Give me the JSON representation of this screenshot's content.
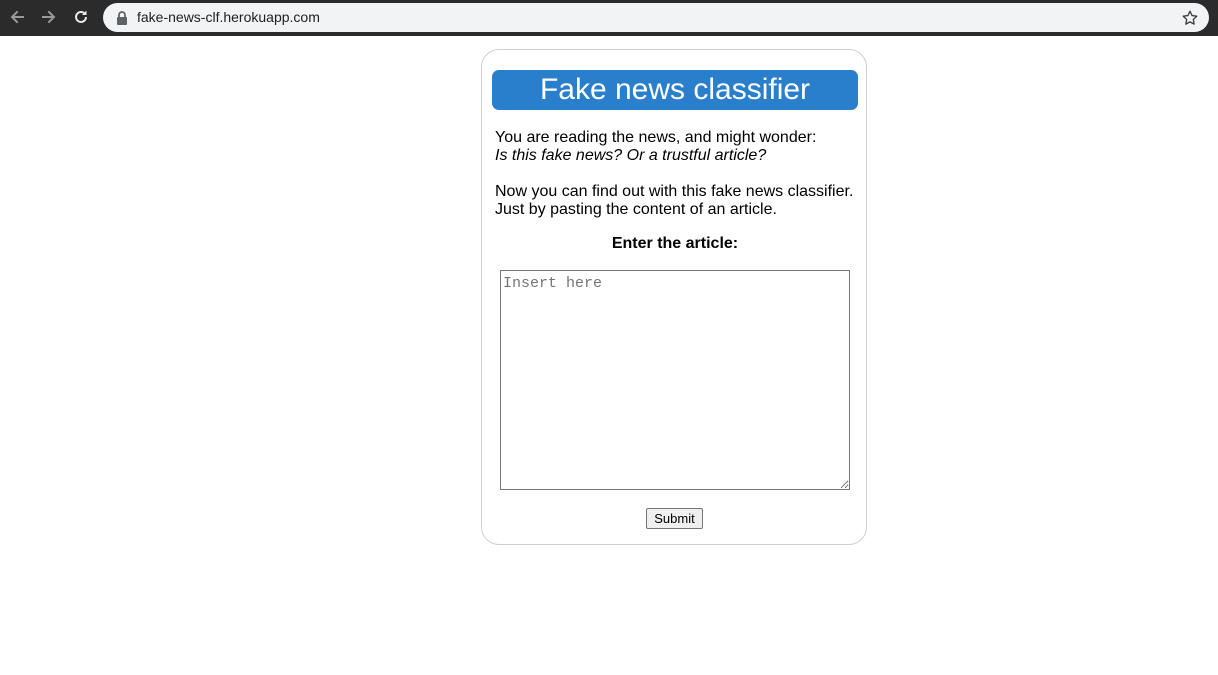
{
  "browser": {
    "url": "fake-news-clf.herokuapp.com",
    "icons": [
      "back-arrow-icon",
      "forward-arrow-icon",
      "reload-icon",
      "lock-icon",
      "star-icon"
    ]
  },
  "page": {
    "title": "Fake news classifier",
    "intro_line1": "You are reading the news, and might wonder:",
    "intro_line2": "Is this fake news? Or a trustful article?",
    "intro_line3": "Now you can find out with this fake news classifier.",
    "intro_line4": "Just by pasting the content of an article.",
    "input_label": "Enter the article:",
    "input_placeholder": "Insert here",
    "input_value": "",
    "submit_label": "Submit"
  },
  "colors": {
    "accent": "#2a7fcc",
    "chrome_dark": "#2b2b2b",
    "url_bar_bg": "#f1f3f4"
  }
}
